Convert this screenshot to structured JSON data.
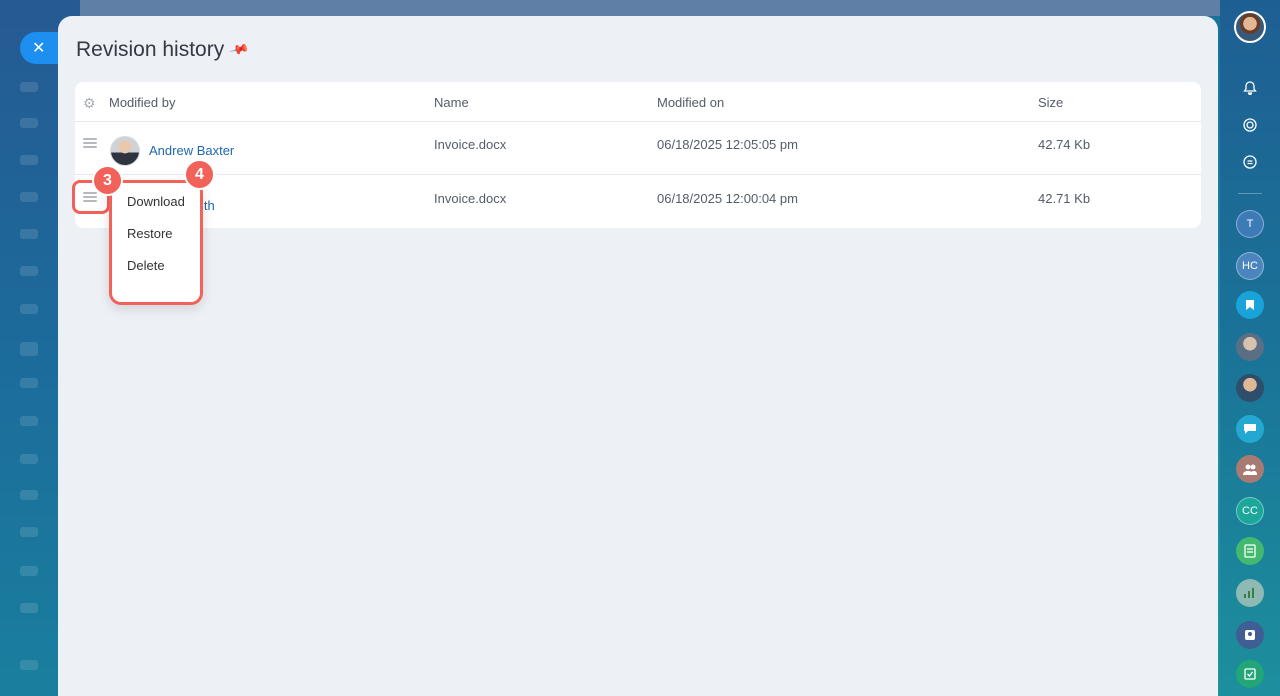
{
  "panel": {
    "title": "Revision history"
  },
  "table": {
    "columns": [
      "Modified by",
      "Name",
      "Modified on",
      "Size"
    ],
    "rows": [
      {
        "user": "Andrew Baxter",
        "name": "Invoice.docx",
        "modified_on": "06/18/2025 12:05:05 pm",
        "size": "42.74 Kb"
      },
      {
        "user_visible_fragment": "ith",
        "name": "Invoice.docx",
        "modified_on": "06/18/2025 12:00:04 pm",
        "size": "42.71 Kb"
      }
    ]
  },
  "context_menu": {
    "items": [
      "Download",
      "Restore",
      "Delete"
    ]
  },
  "annotations": {
    "badge_a": "3",
    "badge_b": "4",
    "color": "#f0625a"
  },
  "rail": {
    "initials": [
      "T",
      "HC",
      "CC"
    ]
  },
  "colors": {
    "accent": "#1d8ff0",
    "link": "#2067b0",
    "panel_bg": "#edf0f4"
  }
}
